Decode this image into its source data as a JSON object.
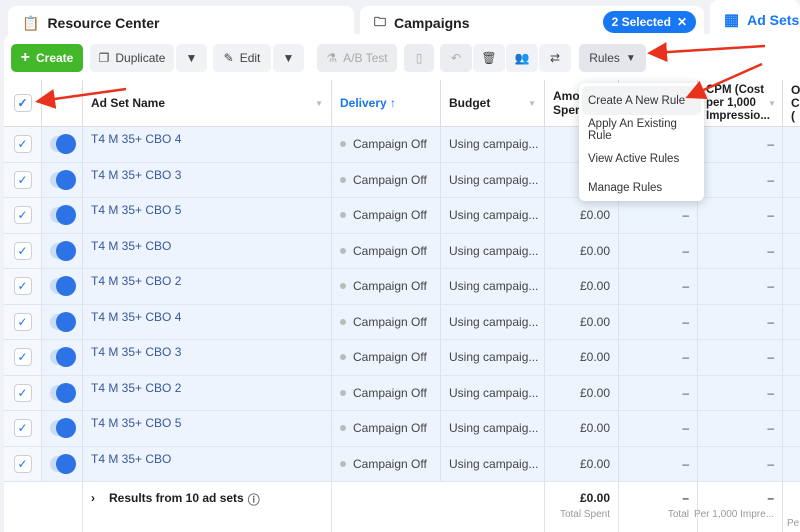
{
  "tabs": [
    {
      "label": "Resource Center",
      "icon": "clipboard-icon"
    },
    {
      "label": "Campaigns",
      "icon": "folder-icon",
      "badge": "2 Selected"
    },
    {
      "label": "Ad Sets",
      "icon": "grid-icon",
      "active": true
    }
  ],
  "toolbar": {
    "create": "Create",
    "duplicate": "Duplicate",
    "edit": "Edit",
    "ab_test": "A/B Test",
    "rules": "Rules"
  },
  "rules_menu": [
    "Create A New Rule",
    "Apply An Existing Rule",
    "View Active Rules",
    "Manage Rules"
  ],
  "columns": {
    "name": "Ad Set Name",
    "delivery": "Delivery ↑",
    "budget": "Budget",
    "amount": "Amount Spent",
    "cpm": "CPM (Cost per 1,000 Impressio...",
    "other": "O C ("
  },
  "rows": [
    {
      "name": "T4 M 35+ CBO 4",
      "delivery": "Campaign Off",
      "budget": "Using campaig...",
      "spent": "",
      "c1": "",
      "cpm": "–"
    },
    {
      "name": "T4 M 35+ CBO 3",
      "delivery": "Campaign Off",
      "budget": "Using campaig...",
      "spent": "",
      "c1": "",
      "cpm": "–"
    },
    {
      "name": "T4 M 35+ CBO 5",
      "delivery": "Campaign Off",
      "budget": "Using campaig...",
      "spent": "£0.00",
      "c1": "–",
      "cpm": "–"
    },
    {
      "name": "T4 M 35+ CBO",
      "delivery": "Campaign Off",
      "budget": "Using campaig...",
      "spent": "£0.00",
      "c1": "–",
      "cpm": "–"
    },
    {
      "name": "T4 M 35+ CBO 2",
      "delivery": "Campaign Off",
      "budget": "Using campaig...",
      "spent": "£0.00",
      "c1": "–",
      "cpm": "–"
    },
    {
      "name": "T4 M 35+ CBO 4",
      "delivery": "Campaign Off",
      "budget": "Using campaig...",
      "spent": "£0.00",
      "c1": "–",
      "cpm": "–"
    },
    {
      "name": "T4 M 35+ CBO 3",
      "delivery": "Campaign Off",
      "budget": "Using campaig...",
      "spent": "£0.00",
      "c1": "–",
      "cpm": "–"
    },
    {
      "name": "T4 M 35+ CBO 2",
      "delivery": "Campaign Off",
      "budget": "Using campaig...",
      "spent": "£0.00",
      "c1": "–",
      "cpm": "–"
    },
    {
      "name": "T4 M 35+ CBO 5",
      "delivery": "Campaign Off",
      "budget": "Using campaig...",
      "spent": "£0.00",
      "c1": "–",
      "cpm": "–"
    },
    {
      "name": "T4 M 35+ CBO",
      "delivery": "Campaign Off",
      "budget": "Using campaig...",
      "spent": "£0.00",
      "c1": "–",
      "cpm": "–"
    }
  ],
  "footer": {
    "label": "Results from 10 ad sets",
    "spent": "£0.00",
    "spent_sub": "Total Spent",
    "c1": "–",
    "c1_sub": "Total",
    "cpm": "–",
    "cpm_sub": "Per 1,000 Impre...",
    "other_sub": "Pe"
  },
  "colors": {
    "accent": "#1877f2",
    "create": "#42b72a",
    "link": "#385898",
    "annotation": "#e8321e"
  }
}
